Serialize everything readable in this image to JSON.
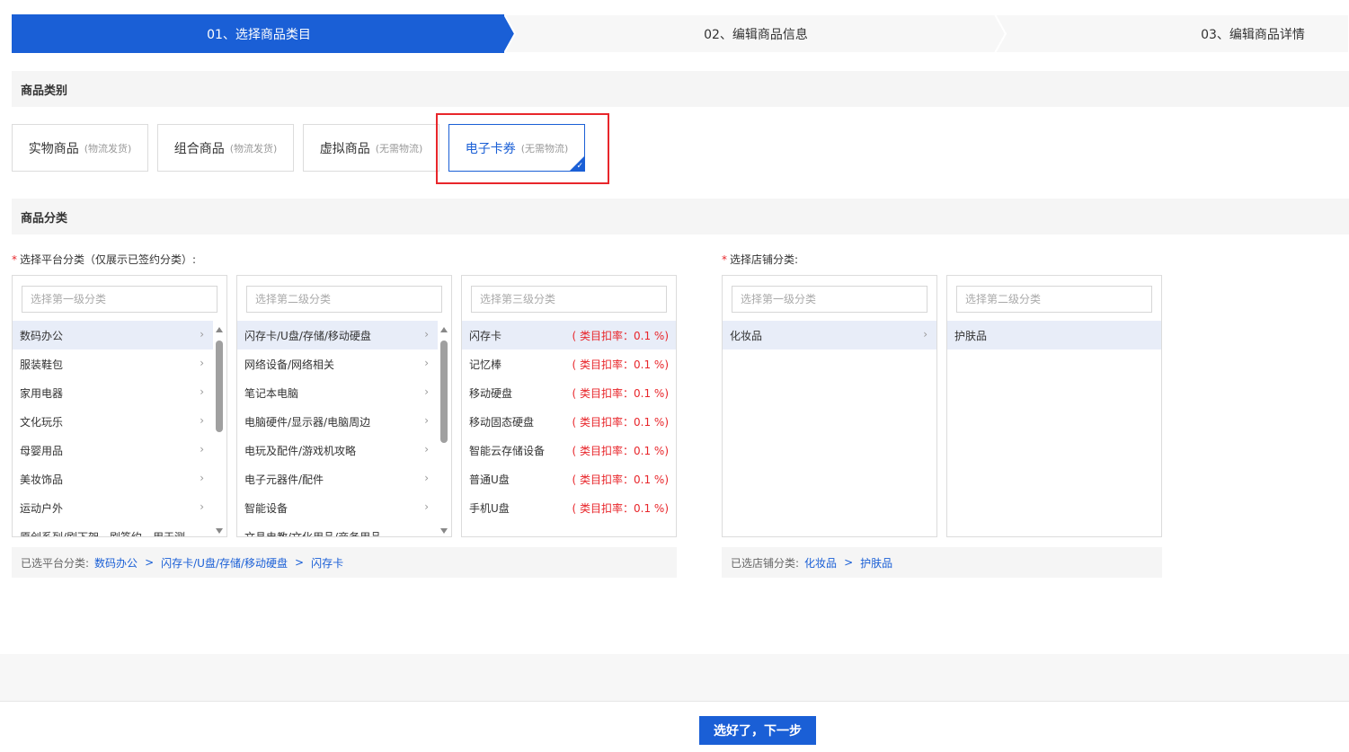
{
  "steps": [
    {
      "label": "01、选择商品类目",
      "active": true
    },
    {
      "label": "02、编辑商品信息",
      "active": false
    },
    {
      "label": "03、编辑商品详情",
      "active": false
    }
  ],
  "sections": {
    "type_title": "商品类别",
    "category_title": "商品分类"
  },
  "product_types": [
    {
      "name": "实物商品",
      "sub": "(物流发货)",
      "selected": false
    },
    {
      "name": "组合商品",
      "sub": "(物流发货)",
      "selected": false
    },
    {
      "name": "虚拟商品",
      "sub": "(无需物流)",
      "selected": false
    },
    {
      "name": "电子卡券",
      "sub": "(无需物流)",
      "selected": true
    }
  ],
  "platform": {
    "label": "选择平台分类（仅展示已签约分类）:",
    "level1": {
      "placeholder": "选择第一级分类",
      "items": [
        "数码办公",
        "服装鞋包",
        "家用电器",
        "文化玩乐",
        "母婴用品",
        "美妆饰品",
        "运动户外",
        "原创系列/刷下架，刷签约，用于测"
      ]
    },
    "level2": {
      "placeholder": "选择第二级分类",
      "items": [
        "闪存卡/U盘/存储/移动硬盘",
        "网络设备/网络相关",
        "笔记本电脑",
        "电脑硬件/显示器/电脑周边",
        "电玩及配件/游戏机攻略",
        "电子元器件/配件",
        "智能设备",
        "文具电教/文化用品/商务用品"
      ]
    },
    "level3": {
      "placeholder": "选择第三级分类",
      "items": [
        {
          "name": "闪存卡",
          "rate": "( 类目扣率：0.1 %)"
        },
        {
          "name": "记忆棒",
          "rate": "( 类目扣率：0.1 %)"
        },
        {
          "name": "移动硬盘",
          "rate": "( 类目扣率：0.1 %)"
        },
        {
          "name": "移动固态硬盘",
          "rate": "( 类目扣率：0.1 %)"
        },
        {
          "name": "智能云存储设备",
          "rate": "( 类目扣率：0.1 %)"
        },
        {
          "name": "普通U盘",
          "rate": "( 类目扣率：0.1 %)"
        },
        {
          "name": "手机U盘",
          "rate": "( 类目扣率：0.1 %)"
        }
      ]
    },
    "selected_label": "已选平台分类:",
    "selected_path": [
      "数码办公",
      "闪存卡/U盘/存储/移动硬盘",
      "闪存卡"
    ]
  },
  "shop": {
    "label": "选择店铺分类:",
    "level1": {
      "placeholder": "选择第一级分类",
      "items": [
        "化妆品"
      ]
    },
    "level2": {
      "placeholder": "选择第二级分类",
      "items": [
        "护肤品"
      ]
    },
    "selected_label": "已选店铺分类:",
    "selected_path": [
      "化妆品",
      "护肤品"
    ]
  },
  "footer": {
    "next_label": "选好了，下一步"
  },
  "colors": {
    "accent": "#1a5fd6",
    "highlight": "#e8262b",
    "rate": "#e8262b"
  }
}
